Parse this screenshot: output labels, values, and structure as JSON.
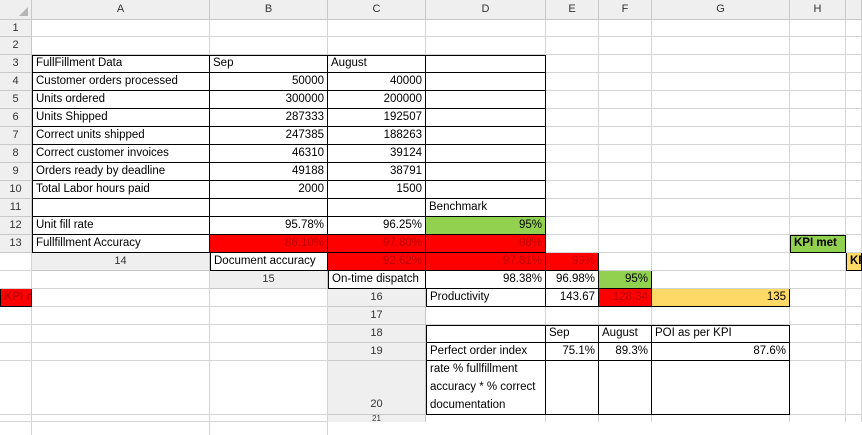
{
  "columns": [
    "A",
    "B",
    "C",
    "D",
    "E",
    "F",
    "G",
    "H"
  ],
  "rows": [
    "1",
    "2",
    "3",
    "4",
    "5",
    "6",
    "7",
    "8",
    "9",
    "10",
    "11",
    "12",
    "13",
    "14",
    "15",
    "16",
    "17",
    "18",
    "19",
    "20",
    "21"
  ],
  "table": {
    "header": {
      "label": "FullFillment Data",
      "sep": "Sep",
      "aug": "August"
    },
    "metrics": [
      {
        "label": "Customer orders processed",
        "sep": "50000",
        "aug": "40000"
      },
      {
        "label": "Units ordered",
        "sep": "300000",
        "aug": "200000"
      },
      {
        "label": "Units Shipped",
        "sep": "287333",
        "aug": "192507"
      },
      {
        "label": "Correct units shipped",
        "sep": "247385",
        "aug": "188263"
      },
      {
        "label": "Correct customer invoices",
        "sep": "46310",
        "aug": "39124"
      },
      {
        "label": "Orders ready by deadline",
        "sep": "49188",
        "aug": "38791"
      },
      {
        "label": "Total Labor hours paid",
        "sep": "2000",
        "aug": "1500"
      }
    ],
    "benchmark_header": "Benchmark",
    "kpis": [
      {
        "label": "Unit fill rate",
        "sep": "95.78%",
        "aug": "96.25%",
        "bench": "95%"
      },
      {
        "label": "Fullfillment Accuracy",
        "sep": "86.10%",
        "aug": "97.80%",
        "bench": "98%"
      },
      {
        "label": "Document accuracy",
        "sep": "92.62%",
        "aug": "97.81%",
        "bench": "99%"
      },
      {
        "label": "On-time dispatch",
        "sep": "98.38%",
        "aug": "96.98%",
        "bench": "95%"
      },
      {
        "label": "Productivity",
        "sep": "143.67",
        "aug": "128.34",
        "bench": "135"
      }
    ]
  },
  "poi": {
    "header": {
      "sep": "Sep",
      "aug": "August",
      "kpi": "POI as per KPI"
    },
    "row": {
      "label": "Perfect order index",
      "sep": "75.1%",
      "aug": "89.3%",
      "kpi": "87.6%"
    },
    "formula": "% on time * % unit fill rate % fullfillment accuracy * % correct documentation"
  },
  "legend": {
    "met": "KPI met",
    "met_one_month": "KPI met for one month",
    "not_met": "KPI not met"
  },
  "colors": {
    "green": "#92d050",
    "red": "#ff0000",
    "yellow": "#ffd966",
    "red_text": "#c00000"
  }
}
